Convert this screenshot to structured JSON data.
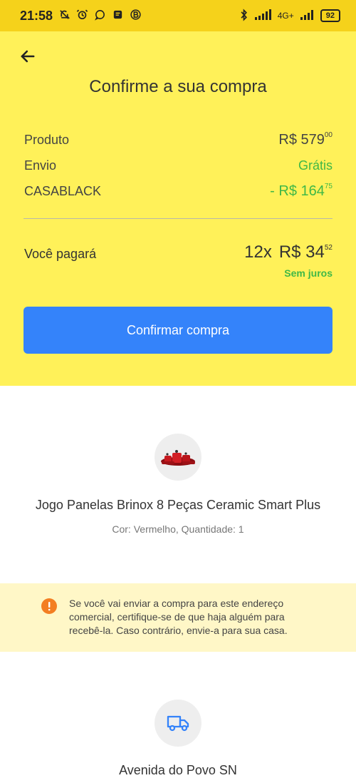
{
  "status_bar": {
    "time": "21:58",
    "network": "4G+",
    "battery": "92"
  },
  "checkout": {
    "title": "Confirme a sua compra",
    "summary": [
      {
        "label": "Produto",
        "value_main": "R$ 579",
        "value_cents": "00",
        "tone": "default"
      },
      {
        "label": "Envio",
        "value_main": "Grátis",
        "value_cents": "",
        "tone": "green"
      },
      {
        "label": "CASABLACK",
        "value_main": "- R$ 164",
        "value_cents": "75",
        "tone": "green"
      }
    ],
    "total": {
      "label": "Você pagará",
      "installments": "12x",
      "amount_main": "R$ 34",
      "amount_cents": "52",
      "interest_text": "Sem juros"
    },
    "confirm_button_label": "Confirmar compra"
  },
  "product": {
    "title": "Jogo Panelas Brinox 8 Peças Ceramic Smart Plus",
    "details": "Cor: Vermelho, Quantidade: 1"
  },
  "notice": {
    "text": "Se você vai enviar a compra para este endereço comercial, certifique-se de que haja alguém para recebê-la. Caso contrário, envie-a para sua casa."
  },
  "shipping": {
    "address": "Avenida do Povo SN"
  },
  "colors": {
    "header_yellow": "#fff159",
    "status_yellow": "#f5d21b",
    "primary_blue": "#3483fa",
    "success_green": "#3fb847",
    "warning_orange": "#f37e22",
    "notice_background": "#fff7c7"
  },
  "icons": {
    "back": "arrow-left-icon",
    "notice": "exclamation-icon",
    "shipping": "truck-icon"
  }
}
